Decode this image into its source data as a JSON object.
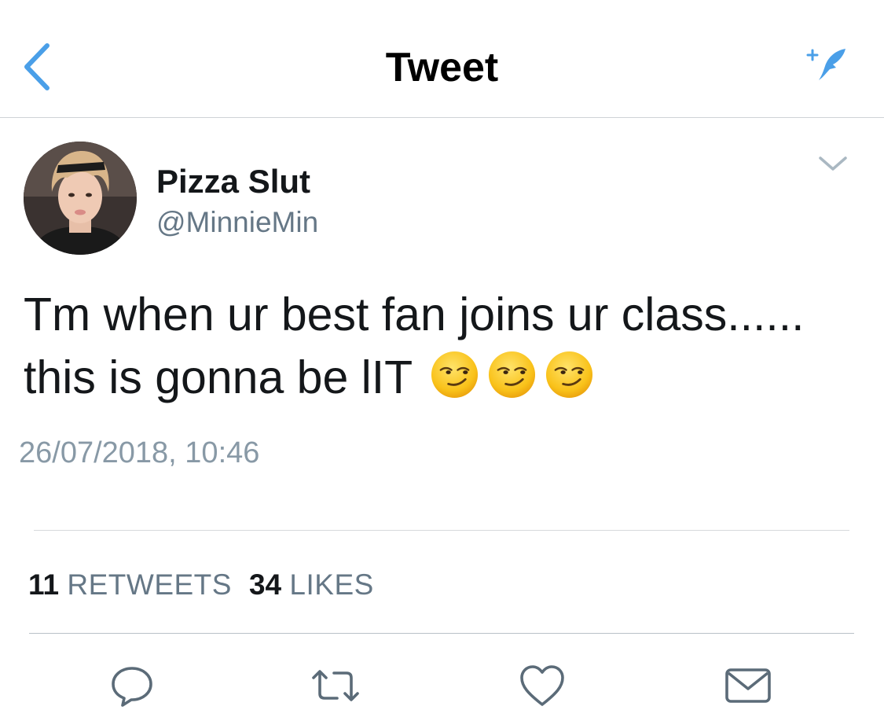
{
  "nav": {
    "title": "Tweet",
    "back_icon": "chevron-left-icon",
    "compose_icon": "compose-feather-icon",
    "accent_color": "#4a9fe8"
  },
  "tweet": {
    "author": {
      "display_name": "Pizza Slut",
      "username": "@MinnieMin",
      "avatar": "profile-photo"
    },
    "text": {
      "line1": "Tm when ur best fan joins ur class......",
      "line2": "this is gonna be lIT"
    },
    "emojis": [
      "smirking-face",
      "smirking-face",
      "smirking-face"
    ],
    "timestamp": "26/07/2018, 10:46",
    "stats": {
      "retweets_count": "11",
      "retweets_label": "RETWEETS",
      "likes_count": "34",
      "likes_label": "LIKES"
    }
  },
  "actions": [
    {
      "name": "reply",
      "icon": "speech-bubble-icon"
    },
    {
      "name": "retweet",
      "icon": "retweet-arrows-icon"
    },
    {
      "name": "like",
      "icon": "heart-icon"
    },
    {
      "name": "direct-message",
      "icon": "envelope-icon"
    }
  ],
  "colors": {
    "text_primary": "#14171a",
    "text_secondary": "#657786",
    "timestamp": "#8899a6",
    "divider": "#d6d9dc",
    "action_icon": "#5b6b78"
  }
}
